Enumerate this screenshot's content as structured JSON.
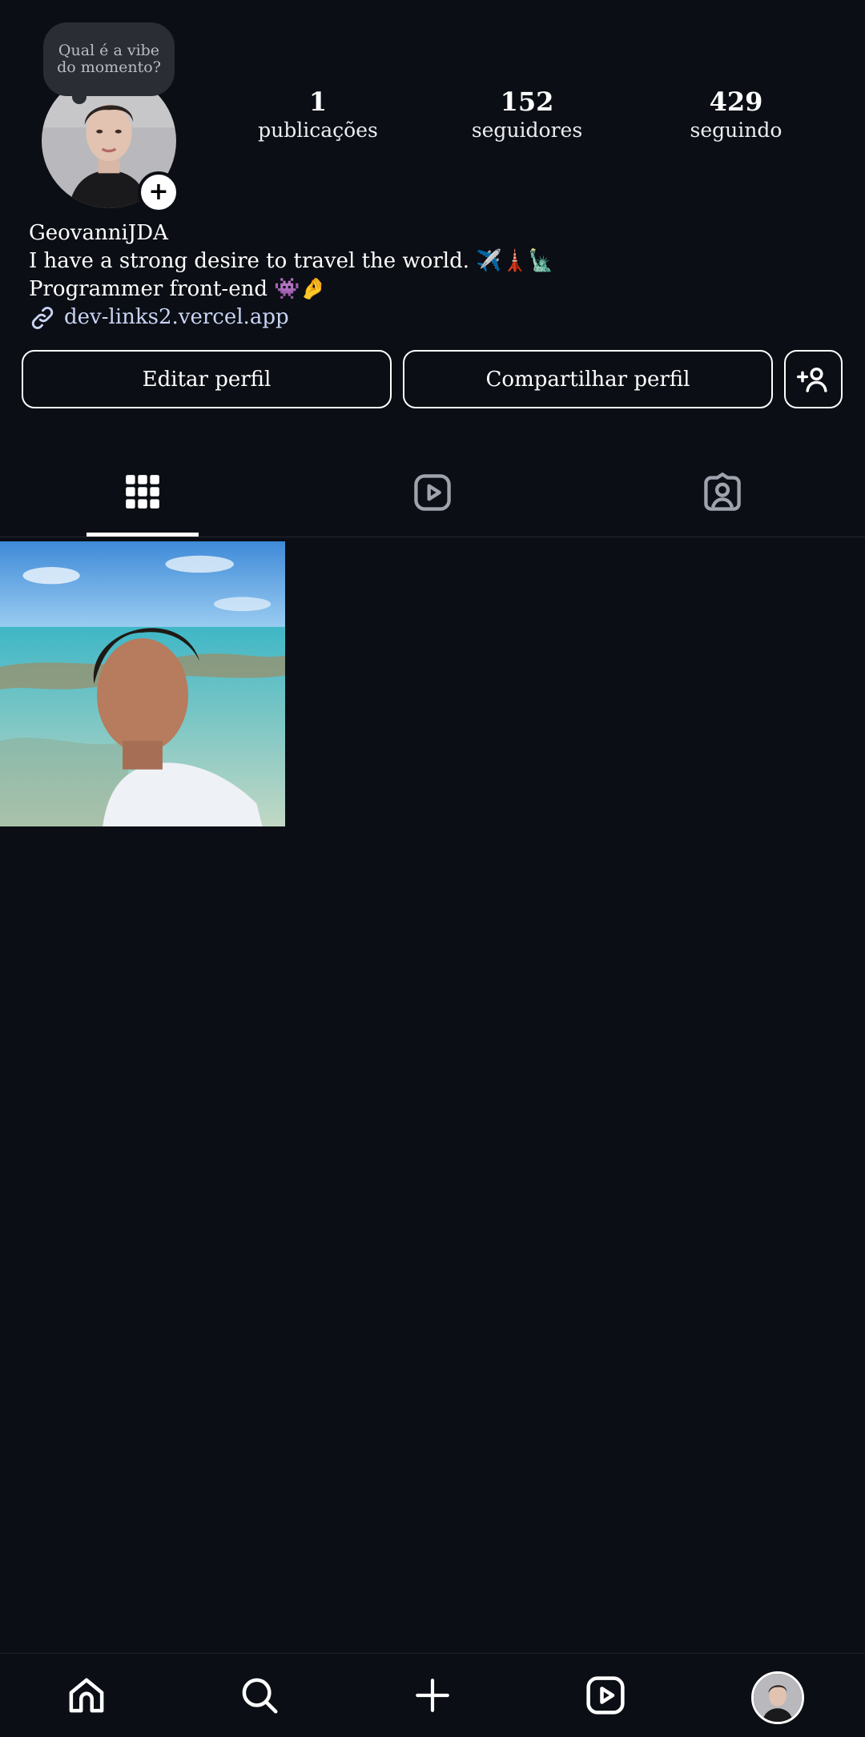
{
  "profile": {
    "note": "Qual é a vibe do momento?",
    "username": "GeovanniJDA",
    "bio_line1": "I have a strong desire to travel the world. ✈️🗼🗽",
    "bio_line2": "Programmer front-end  👾🤌",
    "link": "dev-links2.vercel.app"
  },
  "stats": {
    "posts": {
      "value": "1",
      "label": "publicações"
    },
    "followers": {
      "value": "152",
      "label": "seguidores"
    },
    "following": {
      "value": "429",
      "label": "seguindo"
    }
  },
  "buttons": {
    "edit": "Editar perfil",
    "share": "Compartilhar perfil"
  },
  "tabs": [
    "grid-icon",
    "reels-icon",
    "tagged-icon"
  ],
  "active_tab": "grid-icon",
  "bottom_nav": [
    "home-icon",
    "search-icon",
    "create-icon",
    "reels-icon",
    "profile-avatar"
  ],
  "colors": {
    "background": "#0b0e14",
    "text": "#ffffff",
    "note_bubble": "#2a2d33",
    "link": "#c9d4f5"
  }
}
